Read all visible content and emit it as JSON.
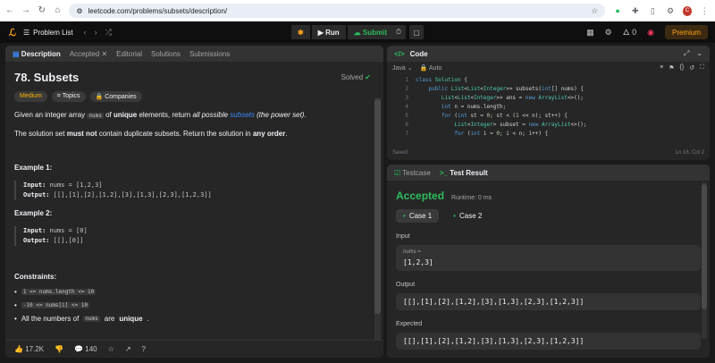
{
  "browser": {
    "url": "leetcode.com/problems/subsets/description/",
    "avatar_letter": "C"
  },
  "topbar": {
    "problem_list": "Problem List",
    "run": "Run",
    "submit": "Submit",
    "streak": "0",
    "premium": "Premium"
  },
  "tabs": {
    "description": "Description",
    "accepted": "Accepted",
    "editorial": "Editorial",
    "solutions": "Solutions",
    "submissions": "Submissions"
  },
  "problem": {
    "title": "78. Subsets",
    "status": "Solved",
    "difficulty": "Medium",
    "topics": "Topics",
    "companies": "Companies",
    "desc_1a": "Given an integer array",
    "desc_code": "nums",
    "desc_1b": "of",
    "desc_unique": "unique",
    "desc_1c": "elements, return",
    "desc_all": "all possible",
    "desc_link": "subsets",
    "desc_power": "(the power set).",
    "desc_2a": "The solution set",
    "desc_mustnot": "must not",
    "desc_2b": "contain duplicate subsets. Return the solution in",
    "desc_any": "any order",
    "desc_2c": ".",
    "ex1_title": "Example 1:",
    "ex1_input_label": "Input:",
    "ex1_input": "nums = [1,2,3]",
    "ex1_output_label": "Output:",
    "ex1_output": "[[],[1],[2],[1,2],[3],[1,3],[2,3],[1,2,3]]",
    "ex2_title": "Example 2:",
    "ex2_input": "nums = [0]",
    "ex2_output": "[[],[0]]",
    "constraints_title": "Constraints:",
    "c1": "1 <= nums.length <= 10",
    "c2": "-10 <= nums[i] <= 10",
    "c3a": "All the numbers of",
    "c3b": "are",
    "c3c": "unique",
    "c3d": "."
  },
  "footer": {
    "likes": "17.2K",
    "comments": "140"
  },
  "code": {
    "title": "Code",
    "language": "Java",
    "mode": "Auto",
    "saved": "Saved",
    "cursor": "Ln 16, Col 2",
    "line_numbers": [
      "1",
      "2",
      "3",
      "4",
      "5",
      "6",
      "7"
    ]
  },
  "result": {
    "testcase_tab": "Testcase",
    "result_tab": "Test Result",
    "status": "Accepted",
    "runtime": "Runtime: 0 ms",
    "case1": "Case 1",
    "case2": "Case 2",
    "input_label": "Input",
    "var_name": "nums =",
    "input_value": "[1,2,3]",
    "output_label": "Output",
    "output_value": "[[],[1],[2],[1,2],[3],[1,3],[2,3],[1,2,3]]",
    "expected_label": "Expected",
    "expected_value": "[[],[1],[2],[1,2],[3],[1,3],[2,3],[1,2,3]]"
  }
}
